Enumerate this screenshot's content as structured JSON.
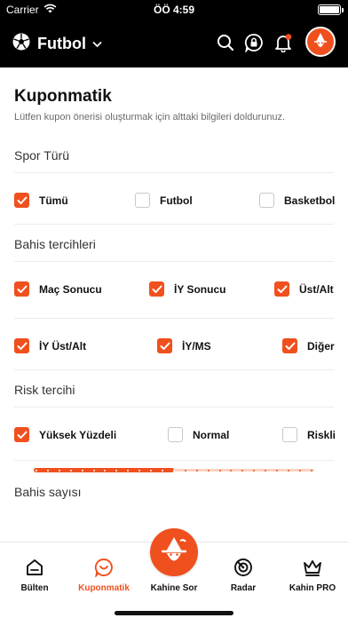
{
  "status_bar": {
    "carrier": "Carrier",
    "time": "ÖÖ 4:59"
  },
  "header": {
    "sport_title": "Futbol",
    "icons": [
      "soccer-ball-icon",
      "chevron-down-icon",
      "search-icon",
      "lock-chat-icon",
      "bell-icon",
      "wizard-avatar-icon"
    ],
    "notification_dot_color": "#f0501e"
  },
  "page": {
    "title": "Kuponmatik",
    "subtitle": "Lütfen kupon önerisi oluşturmak için alttaki bilgileri doldurunuz."
  },
  "sport_type": {
    "title": "Spor Türü",
    "options": [
      {
        "label": "Tümü",
        "checked": true
      },
      {
        "label": "Futbol",
        "checked": false
      },
      {
        "label": "Basketbol",
        "checked": false
      }
    ]
  },
  "bet_prefs": {
    "title": "Bahis tercihleri",
    "options": [
      {
        "label": "Maç Sonucu",
        "checked": true
      },
      {
        "label": "İY Sonucu",
        "checked": true
      },
      {
        "label": "Üst/Alt",
        "checked": true
      },
      {
        "label": "İY Üst/Alt",
        "checked": true
      },
      {
        "label": "İY/MS",
        "checked": true
      },
      {
        "label": "Diğer",
        "checked": true
      }
    ]
  },
  "risk_pref": {
    "title": "Risk tercihi",
    "options": [
      {
        "label": "Yüksek Yüzdeli",
        "checked": true
      },
      {
        "label": "Normal",
        "checked": false
      },
      {
        "label": "Riskli",
        "checked": false
      }
    ]
  },
  "bet_count": {
    "title": "Bahis sayısı",
    "slider_fraction": 0.5
  },
  "bottom_nav": {
    "items": [
      {
        "label": "Bülten",
        "icon": "home-icon",
        "active": false
      },
      {
        "label": "Kuponmatik",
        "icon": "coupon-icon",
        "active": true
      },
      {
        "label": "Kahine Sor",
        "icon": "wizard-icon",
        "active": false
      },
      {
        "label": "Radar",
        "icon": "radar-icon",
        "active": false
      },
      {
        "label": "Kahin PRO",
        "icon": "crown-icon",
        "active": false
      }
    ]
  },
  "colors": {
    "accent": "#f0501e",
    "header_bg": "#000000"
  }
}
